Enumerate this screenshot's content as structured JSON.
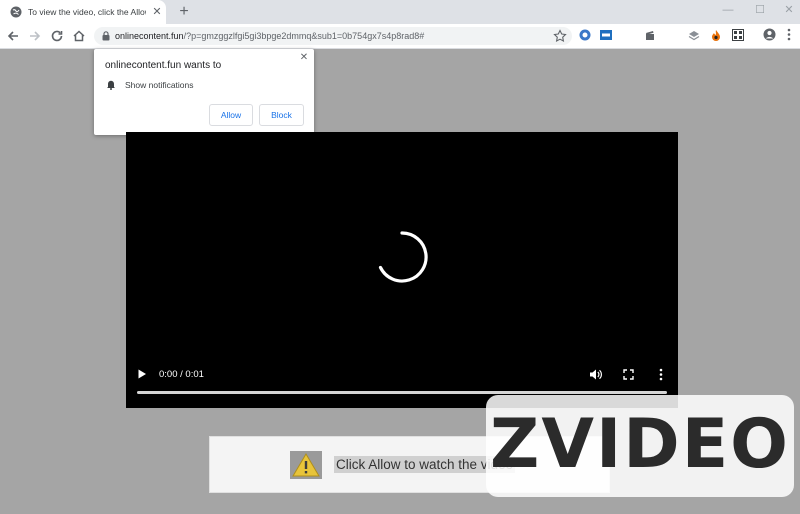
{
  "browser": {
    "tab": {
      "title": "To view the video, click the Allow button",
      "close": "✕"
    },
    "new_tab": "+",
    "window_controls": {
      "minimize": "—",
      "maximize": "☐",
      "close": "✕"
    },
    "address": {
      "host": "onlinecontent.fun",
      "path": "/?p=gmzggzlfgi5gi3bpge2dmmq&sub1=0b754gx7s4p8rad8#"
    }
  },
  "notification_prompt": {
    "title": "onlinecontent.fun wants to",
    "permission": "Show notifications",
    "allow_label": "Allow",
    "block_label": "Block",
    "close": "✕"
  },
  "video": {
    "time": "0:00 / 0:01",
    "progress": 0.0
  },
  "banner": {
    "text": "Click Allow to watch the video"
  },
  "watermark": {
    "text": "ZVIDEO"
  },
  "colors": {
    "accent": "#1a73e8",
    "page_bg": "#a5a5a5",
    "video_bg": "#000000"
  }
}
